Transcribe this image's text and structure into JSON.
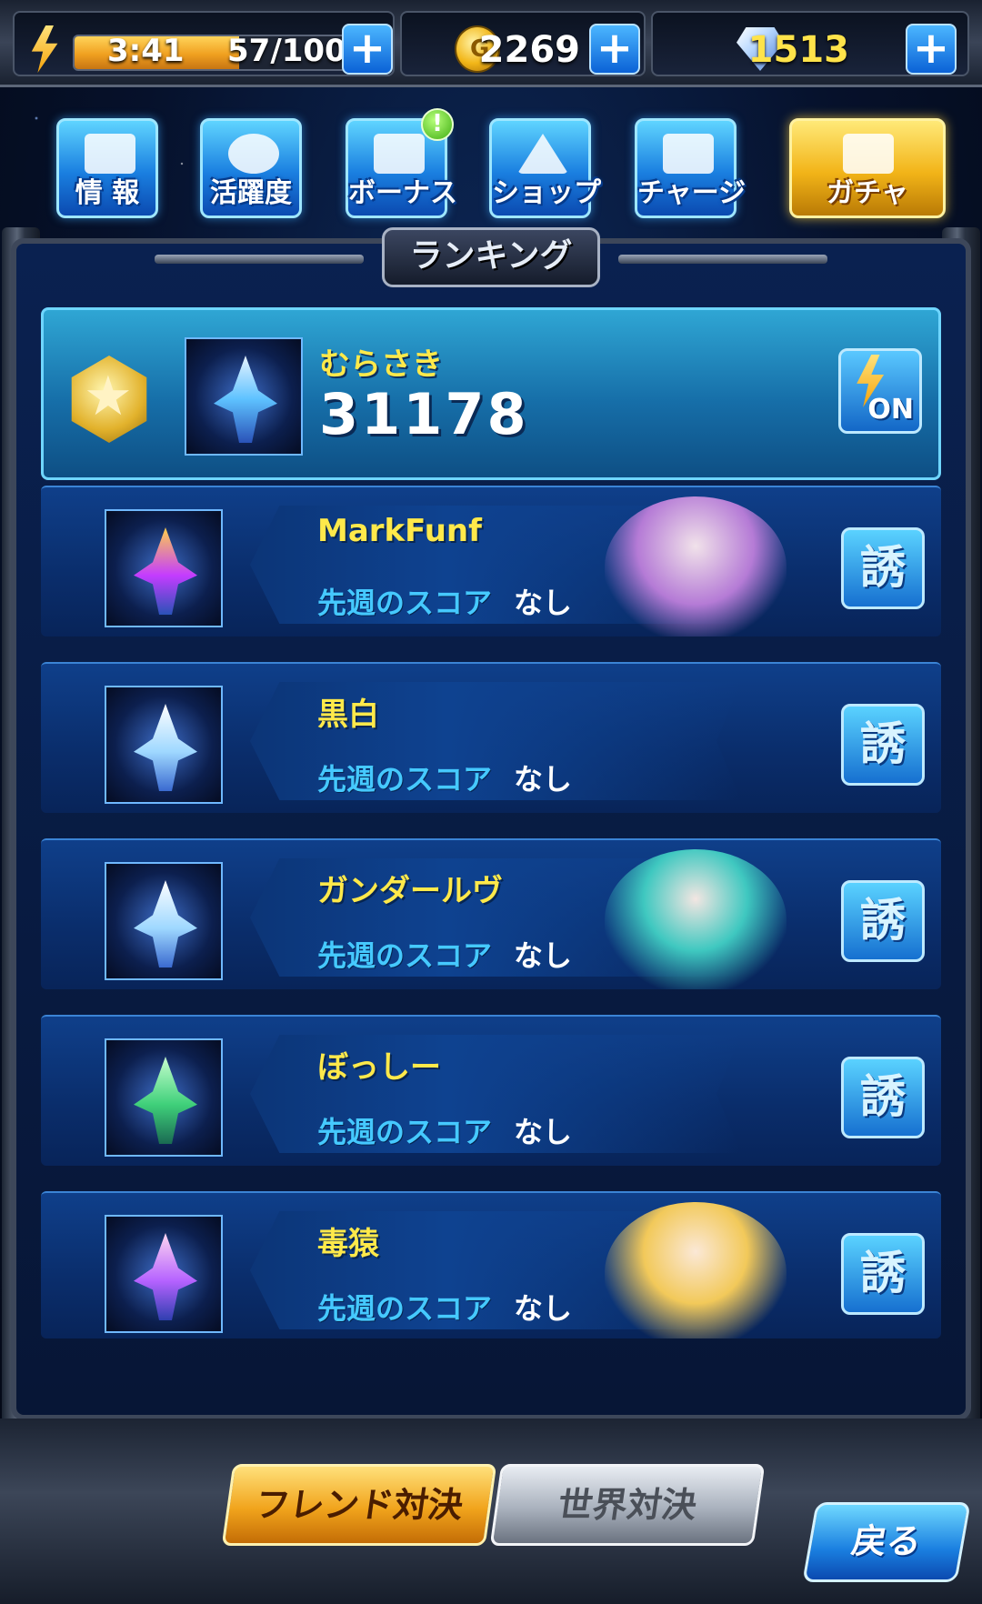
{
  "status": {
    "timer": "3:41",
    "stamina": "57/100",
    "stamina_fraction": 0.57,
    "coins": "2269",
    "gems": "1513",
    "coin_glyph": "G"
  },
  "menu": [
    {
      "label": "情 報",
      "icon": "info-icon"
    },
    {
      "label": "活躍度",
      "icon": "activity-icon"
    },
    {
      "label": "ボーナス",
      "icon": "bonus-icon",
      "badge": "!"
    },
    {
      "label": "ショップ",
      "icon": "shop-icon"
    },
    {
      "label": "チャージ",
      "icon": "charge-icon"
    },
    {
      "label": "ガチャ",
      "icon": "gacha-icon"
    }
  ],
  "ranking": {
    "title": "ランキング",
    "self": {
      "name": "むらさき",
      "score": "31178",
      "toggle": "ON"
    },
    "friends": [
      {
        "name": "MarkFunf",
        "label": "先週のスコア",
        "value": "なし",
        "invite": "誘"
      },
      {
        "name": "黒白",
        "label": "先週のスコア",
        "value": "なし",
        "invite": "誘"
      },
      {
        "name": "ガンダールヴ",
        "label": "先週のスコア",
        "value": "なし",
        "invite": "誘"
      },
      {
        "name": "ぼっしー",
        "label": "先週のスコア",
        "value": "なし",
        "invite": "誘"
      },
      {
        "name": "毒猿",
        "label": "先週のスコア",
        "value": "なし",
        "invite": "誘"
      }
    ]
  },
  "bottom": {
    "friend_battle": "フレンド対決",
    "world_battle": "世界対決",
    "back": "戻る"
  },
  "colors": {
    "accent_gold": "#ffe94a",
    "accent_blue": "#45c9ff",
    "panel_bg": "#0a2150"
  }
}
